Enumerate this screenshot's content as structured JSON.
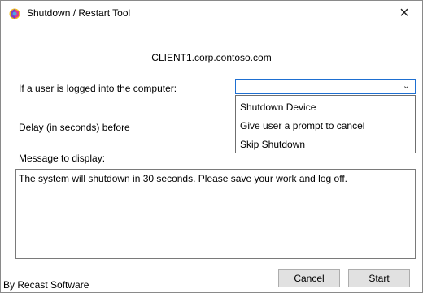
{
  "window": {
    "title": "Shutdown / Restart Tool",
    "close_glyph": "×"
  },
  "hostname": "CLIENT1.corp.contoso.com",
  "logged_in": {
    "label": "If a user is logged into the computer:",
    "selected_value": "",
    "chevron_glyph": "⌄",
    "options": [
      "Shutdown Device",
      "Give user a prompt to cancel",
      "Skip Shutdown"
    ]
  },
  "delay": {
    "label": "Delay (in seconds) before"
  },
  "message": {
    "label": "Message to display:",
    "value": "The system will shutdown in 30 seconds.  Please save your work and log off."
  },
  "buttons": {
    "cancel_label": "Cancel",
    "start_label": "Start"
  },
  "footer": "By Recast Software",
  "icons": {
    "app": "shield-app-icon",
    "close": "close-icon",
    "dropdown": "chevron-down-icon"
  }
}
